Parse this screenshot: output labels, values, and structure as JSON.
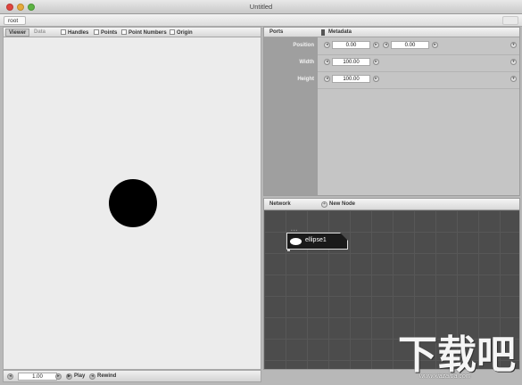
{
  "window": {
    "title": "Untitled"
  },
  "breadcrumb": {
    "root_label": "root"
  },
  "viewer": {
    "tabs": [
      {
        "label": "Viewer",
        "active": true
      },
      {
        "label": "Data",
        "active": false
      }
    ],
    "options": [
      {
        "label": "Handles",
        "checked": false
      },
      {
        "label": "Points",
        "checked": false
      },
      {
        "label": "Point Numbers",
        "checked": false
      },
      {
        "label": "Origin",
        "checked": false
      }
    ],
    "shape_color": "#000000"
  },
  "playback": {
    "frame_value": "1.00",
    "play_label": "Play",
    "rewind_label": "Rewind"
  },
  "ports": {
    "header_label": "Ports",
    "metadata_label": "Metadata",
    "rows": [
      {
        "label": "Position",
        "values": [
          "0.00",
          "0.00"
        ]
      },
      {
        "label": "Width",
        "values": [
          "100.00"
        ]
      },
      {
        "label": "Height",
        "values": [
          "100.00"
        ]
      }
    ]
  },
  "network": {
    "header_label": "Network",
    "new_node_label": "New Node",
    "nodes": [
      {
        "label": "ellipse1"
      }
    ]
  },
  "watermark": {
    "glyph_text": "下载吧",
    "url": "www.xiazaiba.com"
  }
}
